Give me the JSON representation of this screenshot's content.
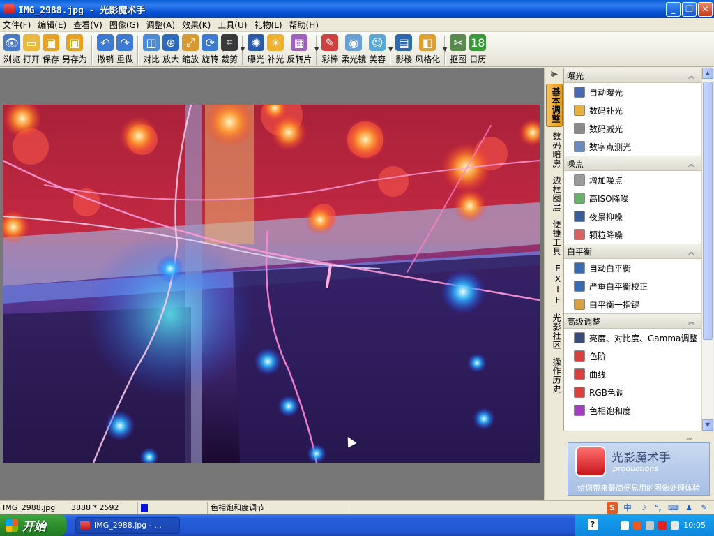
{
  "window": {
    "title": "IMG_2988.jpg - 光影魔术手",
    "controls": {
      "min": "_",
      "max": "❐",
      "close": "✕"
    }
  },
  "menu": [
    "文件(F)",
    "编辑(E)",
    "查看(V)",
    "图像(G)",
    "调整(A)",
    "效果(K)",
    "工具(U)",
    "礼物(L)",
    "帮助(H)"
  ],
  "toolbar": [
    {
      "label": "浏览",
      "icon": "browse-icon",
      "color": "#4a78c8",
      "glyph": "👁"
    },
    {
      "label": "打开",
      "icon": "folder-open-icon",
      "color": "#e8b840",
      "glyph": "▭"
    },
    {
      "label": "保存",
      "icon": "save-icon",
      "color": "#e8a020",
      "glyph": "▣"
    },
    {
      "label": "另存为",
      "icon": "save-as-icon",
      "color": "#e8a020",
      "glyph": "▣"
    },
    {
      "label": "撤销",
      "icon": "undo-icon",
      "color": "#3d7ad6",
      "glyph": "↶"
    },
    {
      "label": "重做",
      "icon": "redo-icon",
      "color": "#3d7ad6",
      "glyph": "↷"
    },
    {
      "label": "对比",
      "icon": "compare-icon",
      "color": "#4a8ad6",
      "glyph": "◫"
    },
    {
      "label": "放大",
      "icon": "zoom-in-icon",
      "color": "#2e6ac0",
      "glyph": "⊕"
    },
    {
      "label": "缩放",
      "icon": "resize-icon",
      "color": "#d89a30",
      "glyph": "⤢"
    },
    {
      "label": "旋转",
      "icon": "rotate-icon",
      "color": "#3d7ad6",
      "glyph": "⟳"
    },
    {
      "label": "裁剪",
      "icon": "crop-icon",
      "color": "#3a3a3a",
      "glyph": "⌗"
    },
    {
      "label": "曝光",
      "icon": "exposure-icon",
      "color": "#2a5aa8",
      "glyph": "✺"
    },
    {
      "label": "补光",
      "icon": "fill-light-icon",
      "color": "#f0b030",
      "glyph": "☀"
    },
    {
      "label": "反转片",
      "icon": "reversal-film-icon",
      "color": "#a060c0",
      "glyph": "▦"
    },
    {
      "label": "彩棒",
      "icon": "color-stick-icon",
      "color": "#d04040",
      "glyph": "✎"
    },
    {
      "label": "柔光镜",
      "icon": "soft-light-icon",
      "color": "#6aa0d8",
      "glyph": "◉"
    },
    {
      "label": "美容",
      "icon": "beauty-icon",
      "color": "#58a8d8",
      "glyph": "☺"
    },
    {
      "label": "影楼",
      "icon": "studio-icon",
      "color": "#3068b0",
      "glyph": "▤"
    },
    {
      "label": "风格化",
      "icon": "stylize-icon",
      "color": "#e0a030",
      "glyph": "◧"
    },
    {
      "label": "抠图",
      "icon": "cutout-icon",
      "color": "#5a8a50",
      "glyph": "✂"
    },
    {
      "label": "日历",
      "icon": "calendar-icon",
      "color": "#3a9a3a",
      "glyph": "18"
    }
  ],
  "vtabs": [
    "基本调整",
    "数码暗房",
    "边框图层",
    "便捷工具",
    "EXIF",
    "光影社区",
    "操作历史"
  ],
  "panel": {
    "sections": [
      {
        "title": "曝光",
        "items": [
          {
            "label": "自动曝光",
            "icon": "auto-exposure-icon",
            "color": "#4a6ab0"
          },
          {
            "label": "数码补光",
            "icon": "digital-fill-light-icon",
            "color": "#e8b040"
          },
          {
            "label": "数码减光",
            "icon": "digital-reduce-light-icon",
            "color": "#8a8a8a"
          },
          {
            "label": "数字点测光",
            "icon": "spot-metering-icon",
            "color": "#6a8ac0"
          }
        ]
      },
      {
        "title": "噪点",
        "items": [
          {
            "label": "增加噪点",
            "icon": "add-noise-icon",
            "color": "#9a9a9a"
          },
          {
            "label": "高ISO降噪",
            "icon": "high-iso-denoise-icon",
            "color": "#6ab06a"
          },
          {
            "label": "夜景抑噪",
            "icon": "night-denoise-icon",
            "color": "#3a5a9a"
          },
          {
            "label": "颗粒降噪",
            "icon": "grain-denoise-icon",
            "color": "#d86060"
          }
        ]
      },
      {
        "title": "白平衡",
        "items": [
          {
            "label": "自动白平衡",
            "icon": "auto-white-balance-icon",
            "color": "#3a6ab0"
          },
          {
            "label": "严重白平衡校正",
            "icon": "severe-white-balance-icon",
            "color": "#3a6ab0"
          },
          {
            "label": "白平衡一指键",
            "icon": "white-balance-one-touch-icon",
            "color": "#d8a040"
          }
        ]
      },
      {
        "title": "高级调整",
        "items": [
          {
            "label": "亮度、对比度、Gamma调整",
            "icon": "brightness-contrast-icon",
            "color": "#3a4a7a"
          },
          {
            "label": "色阶",
            "icon": "levels-icon",
            "color": "#d84040"
          },
          {
            "label": "曲线",
            "icon": "curves-icon",
            "color": "#d84040"
          },
          {
            "label": "RGB色调",
            "icon": "rgb-tone-icon",
            "color": "#d84040"
          },
          {
            "label": "色相饱和度",
            "icon": "hue-saturation-icon",
            "color": "#a040c0"
          }
        ]
      }
    ]
  },
  "promo": {
    "title": "光影魔术手",
    "subtitle": "productions",
    "tagline": "给您带来最简便易用的图像处理体验"
  },
  "status": {
    "filename": "IMG_2988.jpg",
    "dimensions": "3888 * 2592",
    "hint": "色相饱和度调节",
    "swatch_color": "#0a14d8"
  },
  "taskbar": {
    "start": "开始",
    "task": "IMG_2988.jpg - ...",
    "clock": "10:05",
    "help": "?"
  }
}
